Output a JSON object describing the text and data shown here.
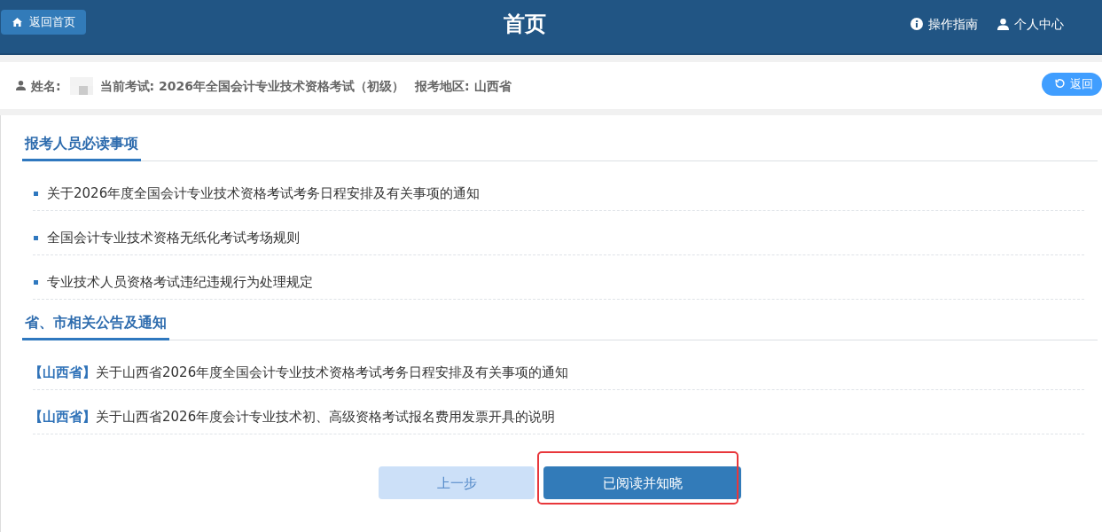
{
  "header": {
    "home_button": "返回首页",
    "title": "首页",
    "links": [
      {
        "kind": "info",
        "label": "操作指南"
      },
      {
        "kind": "user",
        "label": "个人中心"
      }
    ]
  },
  "info_bar": {
    "name_label": "姓名:",
    "exam": "当前考试: 2026年全国会计专业技术资格考试（初级）",
    "region": "报考地区: 山西省",
    "back_button": "返回"
  },
  "sections": [
    {
      "kind": "bulleted",
      "title": "报考人员必读事项",
      "items": [
        {
          "text": "关于2026年度全国会计专业技术资格考试考务日程安排及有关事项的通知"
        },
        {
          "text": "全国会计专业技术资格无纸化考试考场规则"
        },
        {
          "text": "专业技术人员资格考试违纪违规行为处理规定"
        }
      ]
    },
    {
      "kind": "tagged",
      "title": "省、市相关公告及通知",
      "items": [
        {
          "tag": "【山西省】",
          "text": "关于山西省2026年度全国会计专业技术资格考试考务日程安排及有关事项的通知"
        },
        {
          "tag": "【山西省】",
          "text": "关于山西省2026年度会计专业技术初、高级资格考试报名费用发票开具的说明"
        }
      ]
    }
  ],
  "buttons": [
    {
      "kind": "secondary",
      "label": "上一步",
      "highlighted": false
    },
    {
      "kind": "primary",
      "label": "已阅读并知晓",
      "highlighted": true
    }
  ]
}
